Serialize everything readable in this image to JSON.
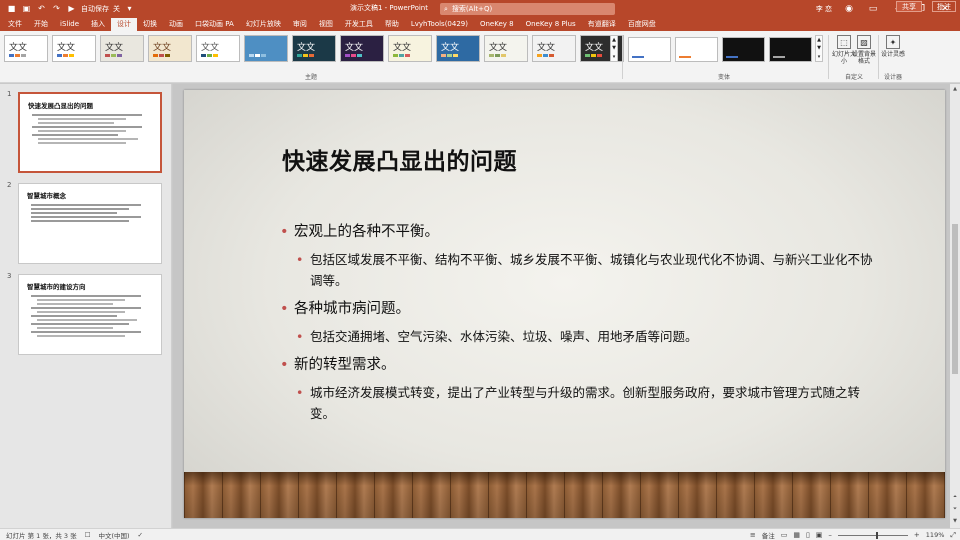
{
  "window": {
    "title": "演示文稿1 - PowerPoint",
    "search_placeholder": "搜索(Alt+Q)",
    "user": "李 恋",
    "qat_autosave": "自动保存",
    "qat_autosave_state": "关"
  },
  "tabs": [
    {
      "label": "文件",
      "active": false
    },
    {
      "label": "开始",
      "active": false
    },
    {
      "label": "iSlide",
      "active": false
    },
    {
      "label": "插入",
      "active": false
    },
    {
      "label": "设计",
      "active": true
    },
    {
      "label": "切换",
      "active": false
    },
    {
      "label": "动画",
      "active": false
    },
    {
      "label": "口袋动画 PA",
      "active": false
    },
    {
      "label": "幻灯片放映",
      "active": false
    },
    {
      "label": "审阅",
      "active": false
    },
    {
      "label": "视图",
      "active": false
    },
    {
      "label": "开发工具",
      "active": false
    },
    {
      "label": "帮助",
      "active": false
    },
    {
      "label": "LvyhTools(0429)",
      "active": false
    },
    {
      "label": "OneKey 8",
      "active": false
    },
    {
      "label": "OneKey 8 Plus",
      "active": false
    },
    {
      "label": "有道翻译",
      "active": false
    },
    {
      "label": "百度网盘",
      "active": false
    }
  ],
  "share_label": "共享",
  "comment_label": "批注",
  "ribbon": {
    "themes": [
      {
        "label": "文文",
        "bg": "#ffffff",
        "fg": "#333333",
        "bars": [
          "#4472c4",
          "#ed7d31",
          "#a5a5a5"
        ]
      },
      {
        "label": "文文",
        "bg": "#ffffff",
        "fg": "#333333",
        "bars": [
          "#4472c4",
          "#ed7d31",
          "#ffc000"
        ]
      },
      {
        "label": "文文",
        "bg": "#e9e7df",
        "fg": "#333333",
        "bars": [
          "#c0504d",
          "#9bbb59",
          "#8064a2"
        ]
      },
      {
        "label": "文文",
        "bg": "#f2e7cf",
        "fg": "#6b3d1b",
        "bars": [
          "#e36c09",
          "#c0504d",
          "#7f6000"
        ]
      },
      {
        "label": "文文",
        "bg": "#ffffff",
        "fg": "#555555",
        "bars": [
          "#1f4e79",
          "#70ad47",
          "#ffc000"
        ]
      },
      {
        "label": "",
        "bg": "#4e8fc3",
        "fg": "#ffffff",
        "bars": [
          "#b7d7f0",
          "#ffffff",
          "#8fbfe0"
        ]
      },
      {
        "label": "文文",
        "bg": "#1b3947",
        "fg": "#ffffff",
        "bars": [
          "#32a59a",
          "#f0c419",
          "#e86a36"
        ]
      },
      {
        "label": "文文",
        "bg": "#2b2042",
        "fg": "#ffffff",
        "bars": [
          "#a14fc5",
          "#e84c8b",
          "#4ec2c7"
        ]
      },
      {
        "label": "文文",
        "bg": "#f7f3df",
        "fg": "#333333",
        "bars": [
          "#8db73b",
          "#4fa3a5",
          "#d65c5c"
        ]
      },
      {
        "label": "文文",
        "bg": "#2e6aa3",
        "fg": "#ffffff",
        "bars": [
          "#f4b183",
          "#a9d18e",
          "#ffd966"
        ]
      },
      {
        "label": "文文",
        "bg": "#f4f4ee",
        "fg": "#333333",
        "bars": [
          "#a8b76f",
          "#7c9a5a",
          "#e2c76a"
        ]
      },
      {
        "label": "文文",
        "bg": "#f2f2f2",
        "fg": "#333333",
        "bars": [
          "#f6a21e",
          "#3e8ed0",
          "#d65a31"
        ]
      },
      {
        "label": "文文",
        "bg": "#2d2d2d",
        "fg": "#ffffff",
        "bars": [
          "#6fbf73",
          "#f1c40f",
          "#e74c3c"
        ]
      }
    ],
    "variants": [
      {
        "bg": "#ffffff",
        "accent": "#4472c4"
      },
      {
        "bg": "#ffffff",
        "accent": "#ed7d31"
      },
      {
        "bg": "#111111",
        "accent": "#4472c4"
      },
      {
        "bg": "#111111",
        "accent": "#a5a5a5"
      }
    ],
    "group_themes": "主题",
    "group_variants": "变体",
    "group_customize": "自定义",
    "group_designer": "设计器",
    "tool_slide_size": "幻灯片大小",
    "tool_format_bg": "设置背景格式",
    "tool_design_ideas": "设计灵感"
  },
  "slides": [
    {
      "number": "1",
      "title": "快速发展凸显出的问题",
      "lines": [
        "b1",
        "b2",
        "b2",
        "b1",
        "b2",
        "b1",
        "b2",
        "b2"
      ],
      "active": true
    },
    {
      "number": "2",
      "title": "智慧城市概念",
      "lines": [
        "b1",
        "b1",
        "b1",
        "b1",
        "b1"
      ],
      "active": false
    },
    {
      "number": "3",
      "title": "智慧城市的建设方向",
      "lines": [
        "b1",
        "b2",
        "b2",
        "b1",
        "b2",
        "b1",
        "b2",
        "b1",
        "b2",
        "b1",
        "b2"
      ],
      "active": false
    }
  ],
  "current_slide": {
    "title": "快速发展凸显出的问题",
    "bullets": [
      {
        "text": "宏观上的各种不平衡。",
        "subs": [
          "包括区域发展不平衡、结构不平衡、城乡发展不平衡、城镇化与农业现代化不协调、与新兴工业化不协调等。"
        ]
      },
      {
        "text": "各种城市病问题。",
        "subs": [
          "包括交通拥堵、空气污染、水体污染、垃圾、噪声、用地矛盾等问题。"
        ]
      },
      {
        "text": "新的转型需求。",
        "subs": [
          "城市经济发展模式转变，提出了产业转型与升级的需求。创新型服务政府，要求城市管理方式随之转变。"
        ]
      }
    ]
  },
  "status": {
    "slide_info": "幻灯片 第 1 张，共 3 张",
    "language": "中文(中国)",
    "notes": "备注",
    "zoom": "119%"
  }
}
